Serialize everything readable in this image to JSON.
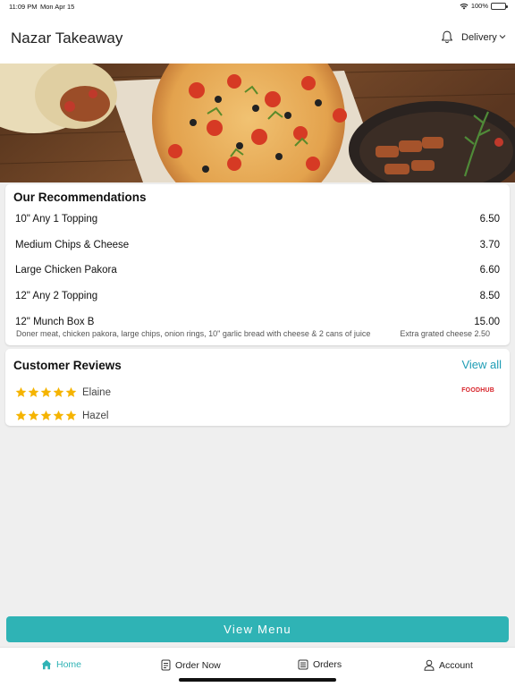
{
  "status_bar": {
    "time": "11:09 PM",
    "date": "Mon Apr 15",
    "battery": "100%",
    "battery_level": 1.0
  },
  "header": {
    "title": "Nazar Takeaway",
    "delivery_label": "Delivery",
    "icons": [
      "bell-icon",
      "chevron-down-icon"
    ]
  },
  "recommendations": {
    "title": "Our Recommendations",
    "items": [
      {
        "name": "10\" Any 1 Topping",
        "price": "6.50"
      },
      {
        "name": "Medium Chips & Cheese",
        "price": "3.70"
      },
      {
        "name": "Large Chicken Pakora",
        "price": "6.60"
      },
      {
        "name": "12\" Any 2 Topping",
        "price": "8.50"
      },
      {
        "name": "12\" Munch Box B",
        "price": "15.00"
      }
    ],
    "munch_description": "Doner meat, chicken pakora, large chips, onion rings, 10\" garlic bread with cheese & 2 cans of juice",
    "munch_extra": "Extra grated cheese 2.50"
  },
  "reviews": {
    "title": "Customer Reviews",
    "view_all": "View all",
    "source": "FOODHUB",
    "items": [
      {
        "name": "Elaine",
        "rating": 5
      },
      {
        "name": "Hazel",
        "rating": 5
      }
    ]
  },
  "view_menu_label": "View Menu",
  "tabs": [
    {
      "label": "Home",
      "icon": "home-icon",
      "active": true
    },
    {
      "label": "Order Now",
      "icon": "order-icon",
      "active": false
    },
    {
      "label": "Orders",
      "icon": "orders-icon",
      "active": false
    },
    {
      "label": "Account",
      "icon": "account-icon",
      "active": false
    }
  ],
  "colors": {
    "accent": "#2fb3b5",
    "link": "#1f9db5",
    "star": "#f5b400",
    "foodhub": "#d8232a"
  }
}
